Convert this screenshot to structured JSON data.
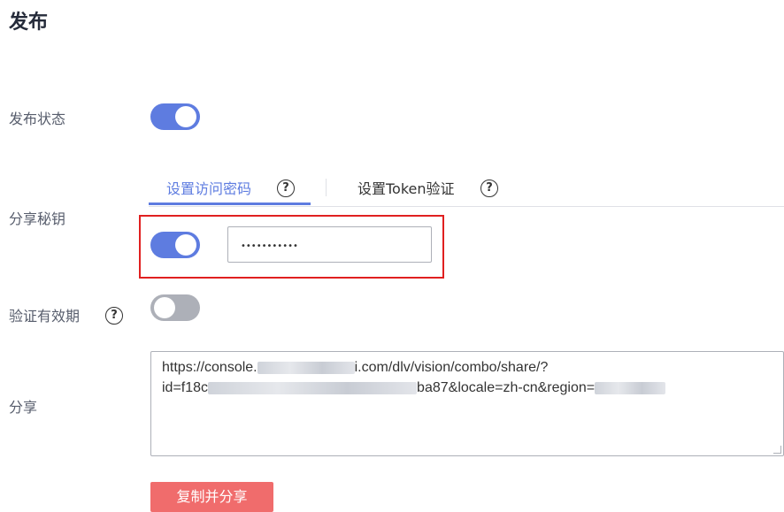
{
  "page": {
    "title": "发布"
  },
  "publish_status": {
    "label": "发布状态",
    "toggle_on": true
  },
  "share_key": {
    "label": "分享秘钥",
    "tabs": [
      {
        "label": "设置访问密码",
        "active": true
      },
      {
        "label": "设置Token验证",
        "active": false
      }
    ],
    "password_toggle_on": true,
    "password_value": "•••••••••••"
  },
  "validity": {
    "label": "验证有效期",
    "toggle_on": false
  },
  "share": {
    "label": "分享",
    "url_line1_prefix": "https://console.",
    "url_line1_suffix": "i.com/dlv/vision/combo/share/?",
    "url_line2_prefix": "id=f18c",
    "url_line2_suffix": "ba87&locale=zh-cn&region="
  },
  "copy_button": {
    "label": "复制并分享"
  },
  "colors": {
    "accent": "#5e7ce0",
    "highlight_border": "#e02020",
    "button": "#f06c6c"
  }
}
